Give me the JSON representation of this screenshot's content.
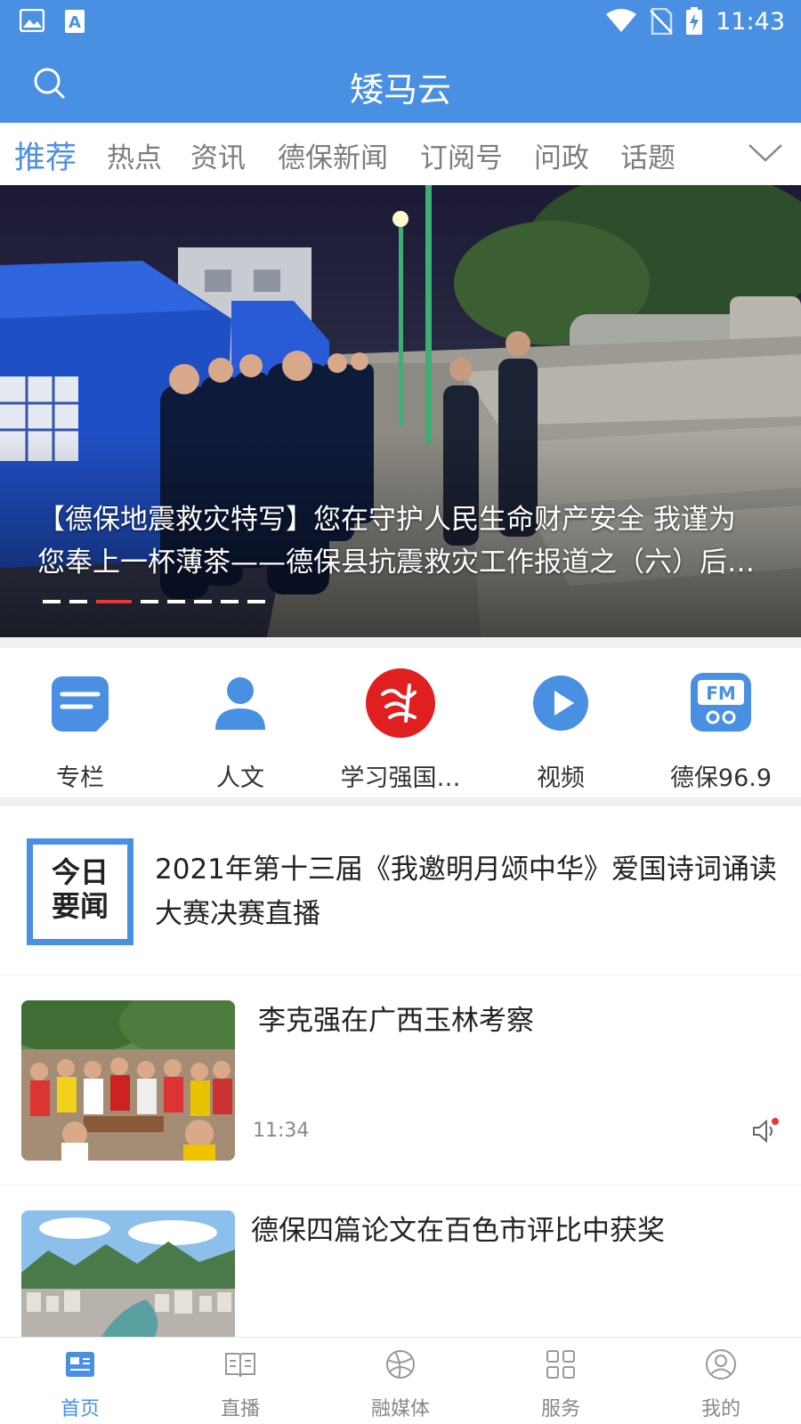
{
  "status_bar": {
    "time": "11:43"
  },
  "app": {
    "title": "矮马云"
  },
  "tabs": [
    {
      "label": "推荐",
      "active": true
    },
    {
      "label": "热点"
    },
    {
      "label": "资讯"
    },
    {
      "label": "德保新闻"
    },
    {
      "label": "订阅号"
    },
    {
      "label": "问政"
    },
    {
      "label": "话题"
    }
  ],
  "banner": {
    "caption_line1": "【德保地震救灾特写】您在守护人民生命财产安全 我谨为",
    "caption_line2": "您奉上一杯薄茶——德保县抗震救灾工作报道之（六）后勤保障",
    "slide_count": 8,
    "active_slide": 3
  },
  "shortcuts": [
    {
      "label": "专栏",
      "icon": "column-icon"
    },
    {
      "label": "人文",
      "icon": "person-icon"
    },
    {
      "label": "学习强国…",
      "icon": "xuexi-logo-icon"
    },
    {
      "label": "视频",
      "icon": "video-play-icon"
    },
    {
      "label": "德保96.9",
      "icon": "fm-radio-icon"
    }
  ],
  "headline": {
    "badge_line1": "今日",
    "badge_line2": "要闻",
    "text": "2021年第十三届《我邀明月颂中华》爱国诗词诵读大赛决赛直播"
  },
  "news": [
    {
      "title": "李克强在广西玉林考察",
      "time": "11:34"
    },
    {
      "title": "德保四篇论文在百色市评比中获奖"
    }
  ],
  "bottom_nav": [
    {
      "label": "首页",
      "icon": "home-news-icon",
      "active": true
    },
    {
      "label": "直播",
      "icon": "live-book-icon"
    },
    {
      "label": "融媒体",
      "icon": "media-ball-icon"
    },
    {
      "label": "服务",
      "icon": "grid-icon"
    },
    {
      "label": "我的",
      "icon": "profile-icon"
    }
  ],
  "colors": {
    "primary": "#4a90e2",
    "accent_red": "#e53935"
  }
}
